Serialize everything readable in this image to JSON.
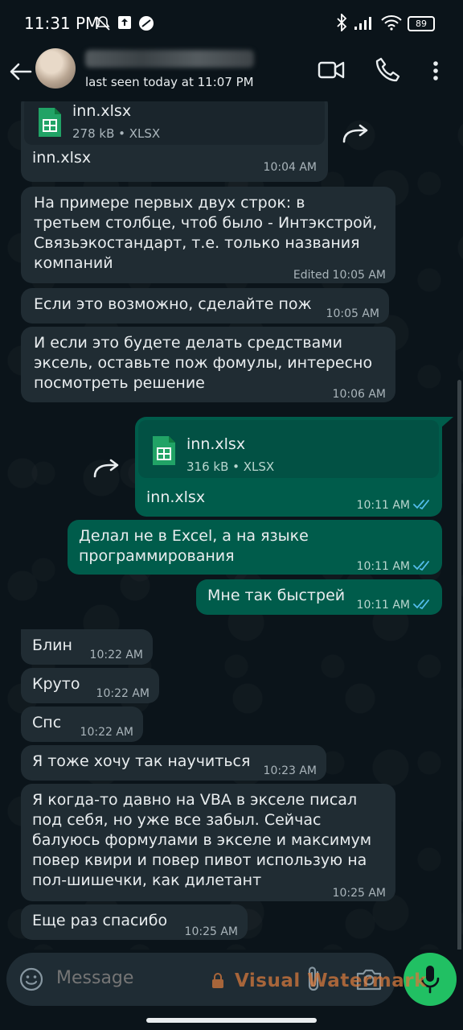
{
  "status_bar": {
    "time": "11:31 PM",
    "battery": "89"
  },
  "header": {
    "last_seen": "last seen today at 11:07 PM"
  },
  "messages": [
    {
      "dir": "in",
      "file": {
        "name": "inn.xlsx",
        "info": "278 kB • XLSX"
      },
      "text": "inn.xlsx",
      "time": "10:04 AM"
    },
    {
      "dir": "in",
      "text": "На примере первых двух строк: в\nтретьем столбце, чтоб было - Интэкстрой,\nСвязьэкостандарт, т.е. только названия\nкомпаний",
      "edited": "Edited",
      "time": "10:05 AM"
    },
    {
      "dir": "in",
      "text": "Если это возможно, сделайте пож",
      "time": "10:05 AM"
    },
    {
      "dir": "in",
      "text": "И если это будете делать средствами\nэксель, оставьте пож фомулы, интересно\nпосмотреть решение",
      "time": "10:06 AM"
    },
    {
      "dir": "out",
      "file": {
        "name": "inn.xlsx",
        "info": "316 kB • XLSX"
      },
      "text": "inn.xlsx",
      "time": "10:11 AM"
    },
    {
      "dir": "out",
      "text": "Делал не в Excel, а на языке\nпрограммирования",
      "time": "10:11 AM"
    },
    {
      "dir": "out",
      "text": "Мне так быстрей",
      "time": "10:11 AM"
    },
    {
      "dir": "in",
      "text": "Блин",
      "time": "10:22 AM"
    },
    {
      "dir": "in",
      "text": "Круто",
      "time": "10:22 AM"
    },
    {
      "dir": "in",
      "text": "Спс",
      "time": "10:22 AM"
    },
    {
      "dir": "in",
      "text": "Я тоже хочу так научиться",
      "time": "10:23 AM"
    },
    {
      "dir": "in",
      "text": "Я когда-то давно на VBA в экселе писал\nпод себя, но уже все забыл. Сейчас\nбалуюсь формулами в экселе и максимум\nповер квири и повер пивот использую на\nпол-шишечки, как дилетант",
      "time": "10:25 AM"
    },
    {
      "dir": "in",
      "text": "Еще раз спасибо",
      "time": "10:25 AM"
    }
  ],
  "input": {
    "placeholder": "Message"
  },
  "watermark": "Visual Watermark",
  "colors": {
    "incoming": "#202c33",
    "outgoing": "#005c4b",
    "ticks": "#53bdeb",
    "mic": "#21c063"
  }
}
